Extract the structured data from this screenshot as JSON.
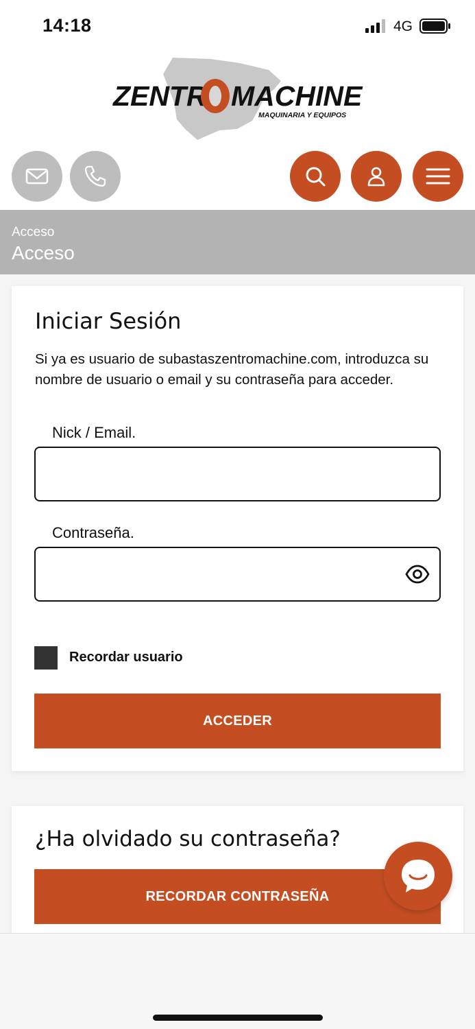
{
  "status_bar": {
    "time": "14:18",
    "network": "4G"
  },
  "brand": {
    "name_left": "ZENTR",
    "name_o": "O",
    "name_right": "MACHINE",
    "tagline": "MAQUINARIA Y EQUIPOS",
    "accent": "#c44e22",
    "grey": "#bdbdbd"
  },
  "header_buttons": [
    {
      "icon": "mail-icon"
    },
    {
      "icon": "phone-icon"
    },
    {
      "icon": "search-icon"
    },
    {
      "icon": "user-icon"
    },
    {
      "icon": "menu-icon"
    }
  ],
  "breadcrumb": {
    "path": "Acceso",
    "title": "Acceso"
  },
  "login": {
    "title": "Iniciar Sesión",
    "intro": "Si ya es usuario de subastaszentromachine.com, introduzca su nombre de usuario o email y su contraseña para acceder.",
    "nick_label": "Nick / Email.",
    "nick_value": "",
    "password_label": "Contraseña.",
    "password_value": "",
    "remember_label": "Recordar usuario",
    "submit_label": "ACCEDER"
  },
  "forgot": {
    "title": "¿Ha olvidado su contraseña?",
    "button_label": "RECORDAR CONTRASEÑA"
  },
  "chat": {
    "icon": "chat-bubble-icon"
  }
}
